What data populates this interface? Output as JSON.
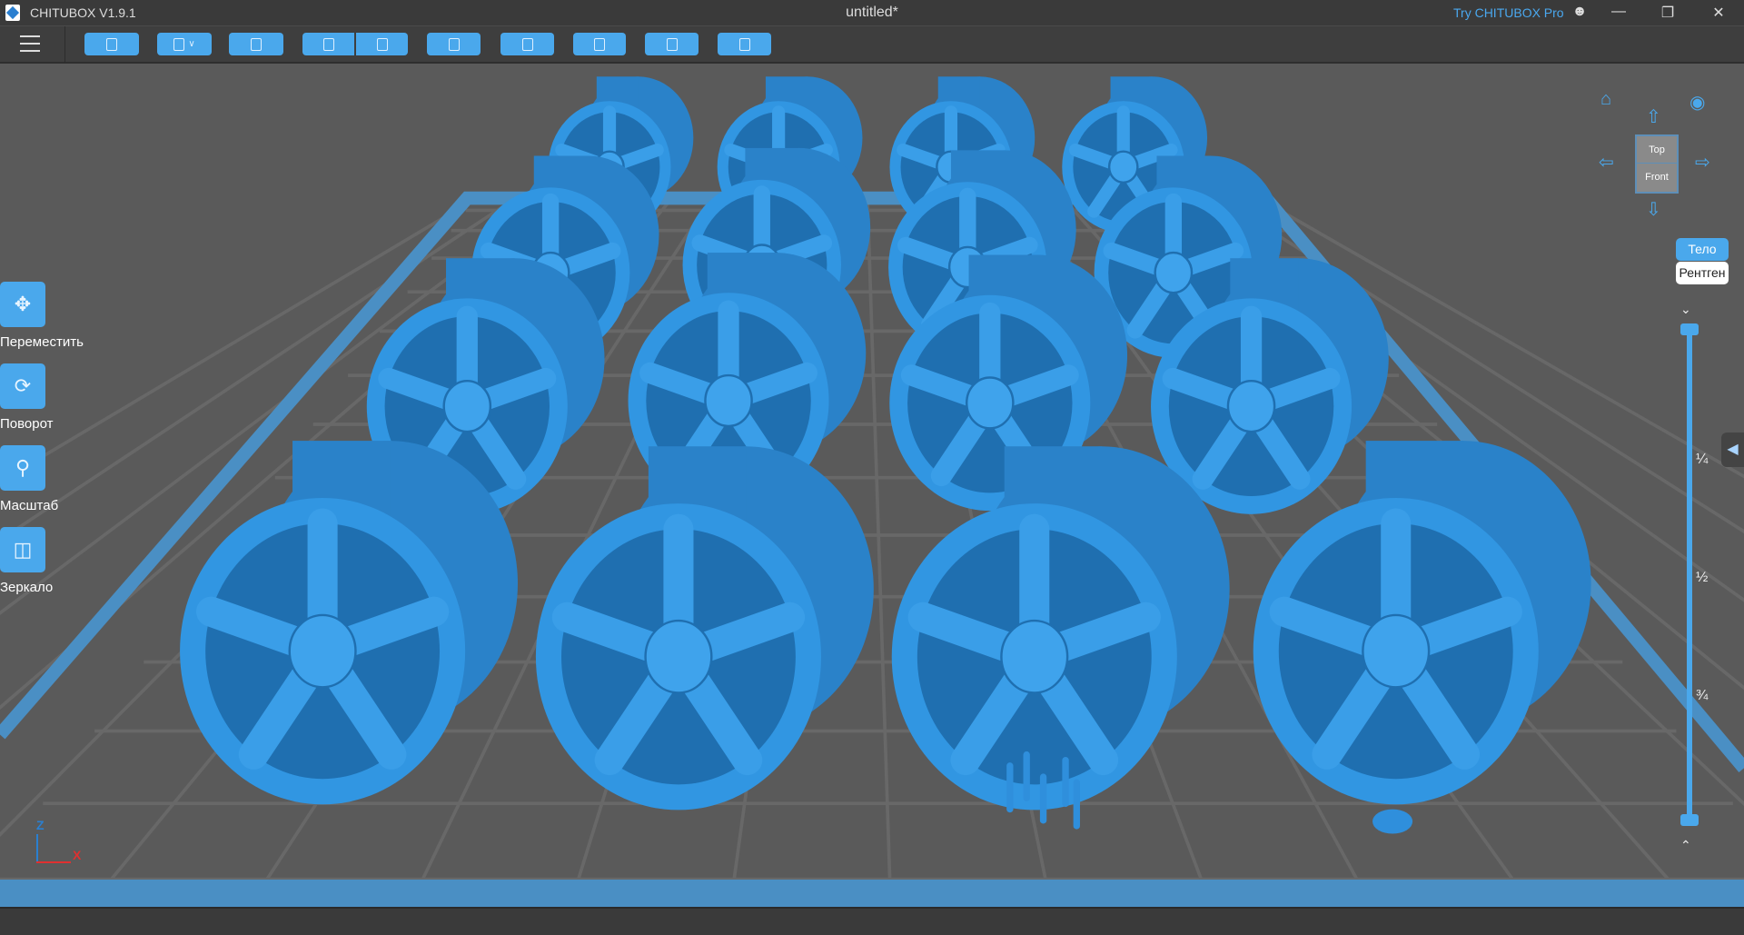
{
  "titlebar": {
    "app_name": "CHITUBOX V1.9.1",
    "document": "untitled*",
    "pro_link": "Try CHITUBOX Pro"
  },
  "toolbar": {
    "buttons": [
      "open-file",
      "save",
      "auto-layout",
      "undo",
      "redo",
      "slice-list",
      "supports",
      "hollow",
      "fill-hole",
      "dig-hole"
    ]
  },
  "tools": [
    {
      "label": "Переместить",
      "icon": "move-icon"
    },
    {
      "label": "Поворот",
      "icon": "rotate-icon"
    },
    {
      "label": "Масштаб",
      "icon": "scale-icon"
    },
    {
      "label": "Зеркало",
      "icon": "mirror-icon"
    }
  ],
  "view_cube": {
    "top": "Top",
    "front": "Front"
  },
  "render_mode": {
    "solid": "Тело",
    "xray": "Рентген",
    "active": "Тело"
  },
  "layer_slider": {
    "marks": [
      "¼",
      "½",
      "¾"
    ],
    "upper": 1.0,
    "lower": 0.0
  },
  "axes": {
    "z": "Z",
    "x": "X"
  },
  "colors": {
    "accent": "#4aa8ec",
    "model": "#2f8fdc",
    "plate_border": "#4a8fc4"
  }
}
